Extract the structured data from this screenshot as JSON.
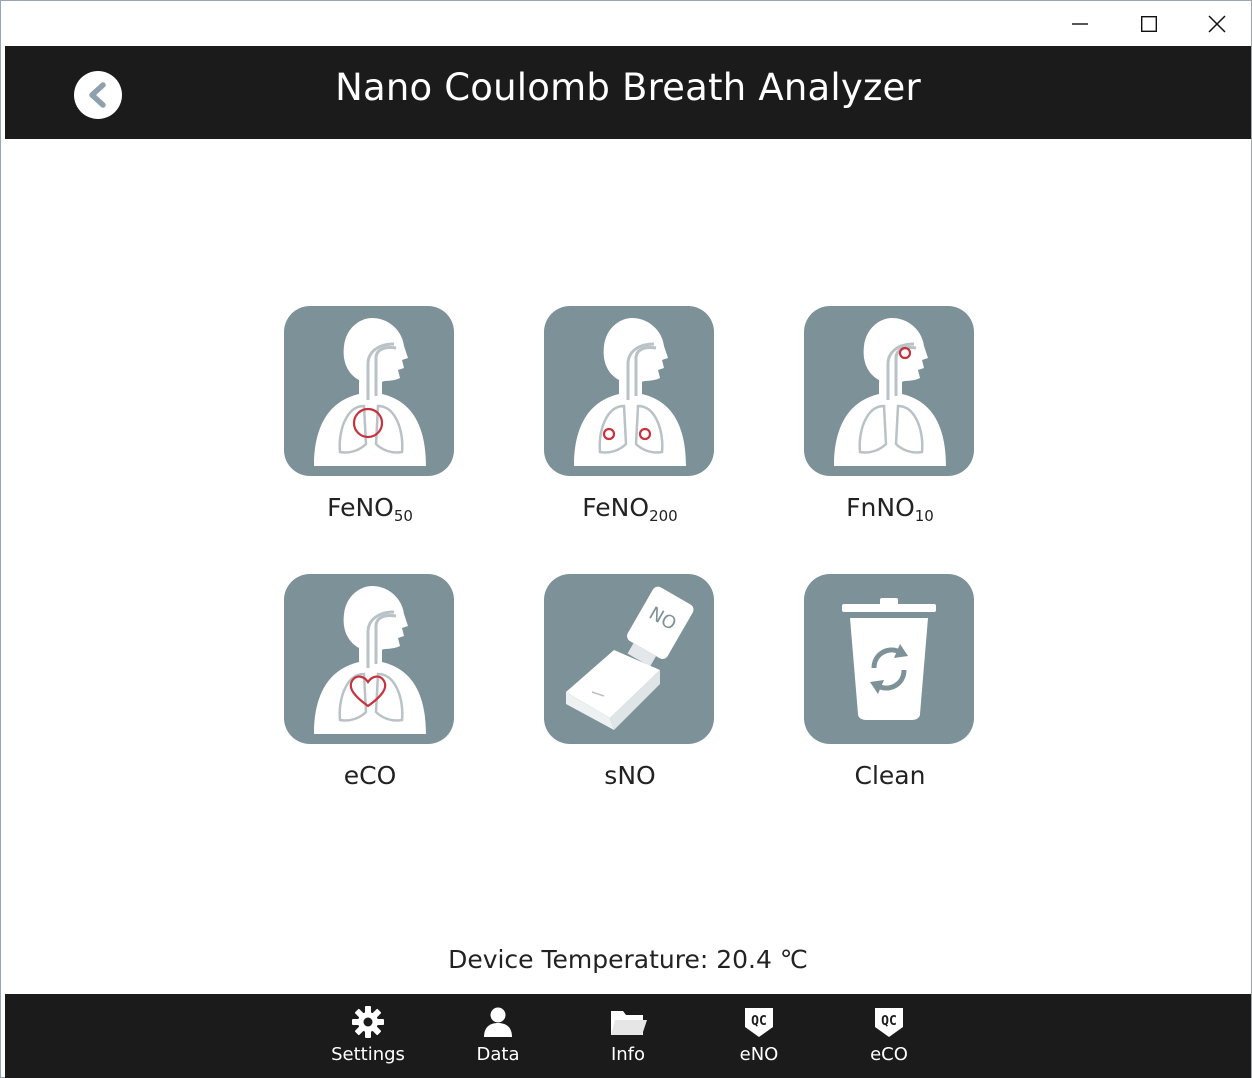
{
  "window": {
    "controls": [
      {
        "name": "minimize-icon"
      },
      {
        "name": "maximize-icon"
      },
      {
        "name": "close-icon"
      }
    ]
  },
  "header": {
    "title": "Nano Coulomb Breath Analyzer",
    "back_icon": "chevron-left-icon"
  },
  "tests": [
    {
      "label": "FeNO",
      "sub": "50",
      "icon": "airway-lungs-icon"
    },
    {
      "label": "FeNO",
      "sub": "200",
      "icon": "airway-alveoli-icon"
    },
    {
      "label": "FnNO",
      "sub": "10",
      "icon": "airway-nose-icon"
    },
    {
      "label": "eCO",
      "sub": "",
      "icon": "airway-heart-icon"
    },
    {
      "label": "sNO",
      "sub": "",
      "icon": "sensor-device-icon"
    },
    {
      "label": "Clean",
      "sub": "",
      "icon": "recycle-bin-icon"
    }
  ],
  "status": {
    "temperature_text": "Device Temperature: 20.4 ℃"
  },
  "nav": {
    "items": [
      {
        "label": "Settings",
        "icon": "gear-icon"
      },
      {
        "label": "Data",
        "icon": "user-icon"
      },
      {
        "label": "Info",
        "icon": "folder-icon"
      },
      {
        "label": "eNO",
        "icon": "qc-badge-icon"
      },
      {
        "label": "eCO",
        "icon": "qc-badge-icon"
      }
    ]
  },
  "colors": {
    "header_bg": "#1b1b1b",
    "tile_bg": "#7d9198",
    "accent_red": "#c8323c"
  }
}
